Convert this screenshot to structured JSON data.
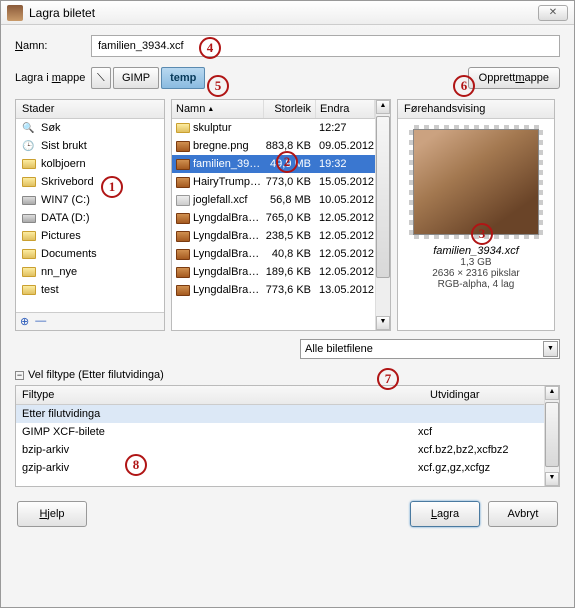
{
  "window": {
    "title": "Lagra biletet",
    "close": "✕"
  },
  "labels": {
    "name": "Namn:",
    "name_underline": "N",
    "folder": "Lagra i mappe",
    "folder_underline": "m"
  },
  "filename": "familien_3934.xcf",
  "path_segments": [
    {
      "label": "⟍",
      "active": false,
      "icon": true
    },
    {
      "label": "GIMP",
      "active": false,
      "icon": false
    },
    {
      "label": "temp",
      "active": true,
      "icon": false
    }
  ],
  "create_folder": "Opprett mappe",
  "create_folder_u": "m",
  "places": {
    "header": "Stader",
    "items": [
      {
        "icon": "search",
        "label": "Søk"
      },
      {
        "icon": "recent",
        "label": "Sist brukt"
      },
      {
        "icon": "folder",
        "label": "kolbjoern"
      },
      {
        "icon": "folder",
        "label": "Skrivebord"
      },
      {
        "icon": "drive",
        "label": "WIN7 (C:)"
      },
      {
        "icon": "drive",
        "label": "DATA (D:)"
      },
      {
        "icon": "folder",
        "label": "Pictures"
      },
      {
        "icon": "folder",
        "label": "Documents"
      },
      {
        "icon": "folder",
        "label": "nn_nye"
      },
      {
        "icon": "folder",
        "label": "test"
      }
    ],
    "add": "⊕",
    "remove": "—"
  },
  "filelist": {
    "cols": {
      "name": "Namn",
      "size": "Storleik",
      "date": "Endra"
    },
    "rows": [
      {
        "icon": "folder",
        "name": "skulptur",
        "size": "",
        "date": "12:27",
        "sel": false
      },
      {
        "icon": "img",
        "name": "bregne.png",
        "size": "883,8 KB",
        "date": "09.05.2012",
        "sel": false
      },
      {
        "icon": "img",
        "name": "familien_39…",
        "size": "49,9 MB",
        "date": "19:32",
        "sel": true
      },
      {
        "icon": "img",
        "name": "HairyTrump…",
        "size": "773,0 KB",
        "date": "15.05.2012",
        "sel": false
      },
      {
        "icon": "xcf",
        "name": "joglefall.xcf",
        "size": "56,8 MB",
        "date": "10.05.2012",
        "sel": false
      },
      {
        "icon": "img",
        "name": "LyngdalBra…",
        "size": "765,0 KB",
        "date": "12.05.2012",
        "sel": false
      },
      {
        "icon": "img",
        "name": "LyngdalBra…",
        "size": "238,5 KB",
        "date": "12.05.2012",
        "sel": false
      },
      {
        "icon": "img",
        "name": "LyngdalBra…",
        "size": "40,8 KB",
        "date": "12.05.2012",
        "sel": false
      },
      {
        "icon": "img",
        "name": "LyngdalBra…",
        "size": "189,6 KB",
        "date": "12.05.2012",
        "sel": false
      },
      {
        "icon": "img",
        "name": "LyngdalBra…",
        "size": "773,6 KB",
        "date": "13.05.2012",
        "sel": false
      }
    ]
  },
  "preview": {
    "header": "Førehandsvising",
    "name": "familien_3934.xcf",
    "line1": "1,3 GB",
    "line2": "2636 × 2316 pikslar",
    "line3": "RGB-alpha, 4 lag"
  },
  "filter": {
    "label": "Alle biletfilene"
  },
  "expander": {
    "label": "Vel filtype (Etter filutvidinga)"
  },
  "filetypes": {
    "cols": {
      "type": "Filtype",
      "ext": "Utvidingar"
    },
    "rows": [
      {
        "type": "Etter filutvidinga",
        "ext": "",
        "sel": true
      },
      {
        "type": "GIMP XCF-bilete",
        "ext": "xcf",
        "sel": false
      },
      {
        "type": "bzip-arkiv",
        "ext": "xcf.bz2,bz2,xcfbz2",
        "sel": false
      },
      {
        "type": "gzip-arkiv",
        "ext": "xcf.gz,gz,xcfgz",
        "sel": false
      }
    ]
  },
  "buttons": {
    "help": "Hjelp",
    "help_u": "H",
    "save": "Lagra",
    "save_u": "L",
    "cancel": "Avbryt"
  },
  "annotations": [
    "1",
    "2",
    "3",
    "4",
    "5",
    "6",
    "7",
    "8"
  ]
}
